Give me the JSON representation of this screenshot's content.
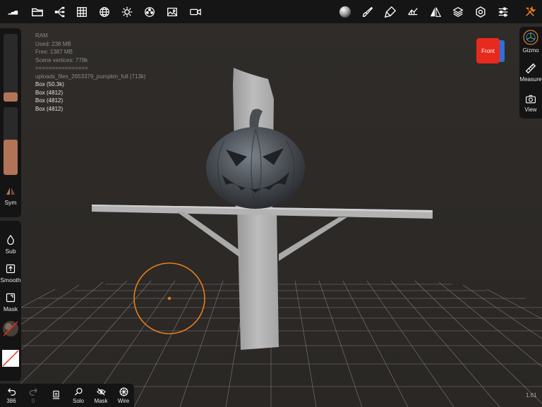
{
  "toolbar": {
    "icons": [
      "logo-icon",
      "folder-icon",
      "scene-tree-icon",
      "grid-icon",
      "globe-icon",
      "sun-icon",
      "material-ball-icon",
      "image-icon",
      "camera-icon",
      "matcap-sphere-icon",
      "brush-icon",
      "painter-icon",
      "topology-icon",
      "mirror-icon",
      "layers-icon",
      "settings-icon",
      "sliders-icon",
      "tools-icon"
    ]
  },
  "stats": {
    "ram": "RAM",
    "used": "Used: 238 MB",
    "free": "Free: 1387 MB",
    "vertices": "Scene vertices: 778k",
    "separator": "================",
    "file": "uploads_files_2653379_pumpkin_full (713k)",
    "objects": [
      "Box (50.3k)",
      "Box (4812)",
      "Box (4812)",
      "Box (4812)"
    ]
  },
  "left_panel": {
    "radius_slider_value": 0.14,
    "intensity_slider_value": 0.52,
    "sym_label": "Sym",
    "sub_label": "Sub",
    "smooth_label": "Smooth",
    "mask_label": "Mask"
  },
  "right_panel": {
    "gizmo_label": "Gizmo",
    "measure_label": "Measure",
    "view_label": "View",
    "cube_label": "Front"
  },
  "bottom_bar": {
    "undo_count": "386",
    "redo_count": "0",
    "solo_label": "Solo",
    "mask_label": "Mask",
    "wire_label": "Wire"
  },
  "version": "1.61",
  "colors": {
    "accent": "#e67e1c",
    "slider_fill": "#b27456",
    "cube_front": "#e82a1e",
    "cube_side": "#2f6fd6"
  }
}
